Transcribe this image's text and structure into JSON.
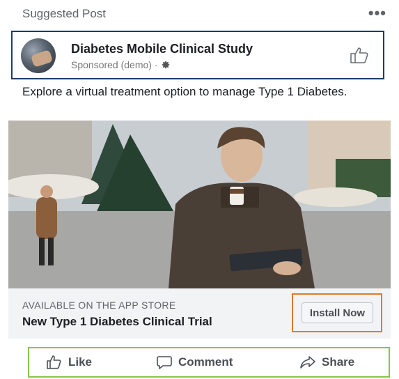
{
  "header": {
    "label": "Suggested Post",
    "more_icon": "ellipsis-icon",
    "more_symbol": "•••"
  },
  "author": {
    "name": "Diabetes Mobile Clinical Study",
    "meta": "Sponsored (demo) ·",
    "settings_icon": "gear-icon",
    "like_icon": "thumbs-up-icon"
  },
  "post": {
    "text": "Explore a virtual treatment option to manage Type 1 Diabetes."
  },
  "media": {
    "description_icon": "photo"
  },
  "cta": {
    "source": "AVAILABLE ON THE APP STORE",
    "title": "New Type 1 Diabetes Clinical Trial",
    "button_label": "Install Now"
  },
  "actions": [
    {
      "label": "Like",
      "icon": "thumbs-up-icon"
    },
    {
      "label": "Comment",
      "icon": "comment-icon"
    },
    {
      "label": "Share",
      "icon": "share-icon"
    }
  ],
  "colors": {
    "author_box_border": "#1f3b66",
    "cta_border": "#e07a2b",
    "actions_border": "#8bc34a"
  }
}
